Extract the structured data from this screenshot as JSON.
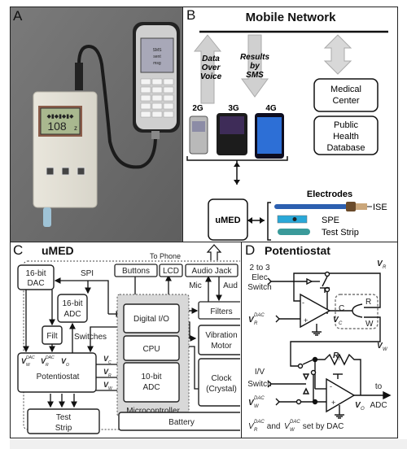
{
  "figure": {
    "panels": {
      "a": {
        "label": "A",
        "device_lcd": {
          "top_row": "◆▮◆▮◆▮◆",
          "reading": "108",
          "unit_mark": "z"
        },
        "phone_screen_lines": [
          "SMS",
          "sent",
          "msg"
        ]
      },
      "b": {
        "label": "B",
        "title": "Mobile Network",
        "arrow_up_text": [
          "Data",
          "Over",
          "Voice"
        ],
        "arrow_down_text": [
          "Results",
          "by",
          "SMS"
        ],
        "phone_generations": [
          "2G",
          "3G",
          "4G"
        ],
        "boxes": {
          "medical_center": [
            "Medical",
            "Center"
          ],
          "public_health": [
            "Public",
            "Health",
            "Database"
          ],
          "umed": "uMED"
        },
        "electrodes_title": "Electrodes",
        "electrodes": [
          "ISE",
          "SPE",
          "Test Strip"
        ]
      },
      "c": {
        "label": "C",
        "title": "uMED",
        "to_phone": "To Phone",
        "blocks": {
          "dac": [
            "16-bit",
            "DAC"
          ],
          "spi": "SPI",
          "adc16": [
            "16-bit",
            "ADC"
          ],
          "filt": "Filt",
          "switches": "Switches",
          "potentiostat": "Potentiostat",
          "pot_inputs": [
            "V",
            "V",
            "V"
          ],
          "pot_input_sup": [
            "DAC",
            "DAC",
            ""
          ],
          "pot_input_sub": [
            "W",
            "R",
            "O"
          ],
          "pot_outputs": [
            "V",
            "V",
            "V"
          ],
          "pot_output_sub": [
            "C",
            "R",
            "W"
          ],
          "buttons": "Buttons",
          "lcd": "LCD",
          "audio_jack": "Audio Jack",
          "mic": "Mic",
          "aud": "Aud",
          "filters": "Filters",
          "digital_io": "Digital I/O",
          "cpu": "CPU",
          "adc10": [
            "10-bit",
            "ADC"
          ],
          "microcontroller": "Microcontroller",
          "vibration_motor": [
            "Vibration",
            "Motor"
          ],
          "clock": [
            "Clock",
            "(Crystal)"
          ],
          "test_strip": [
            "Test",
            "Strip"
          ],
          "battery": "Battery"
        }
      },
      "d": {
        "label": "D",
        "title": "Potentiostat",
        "elec_switch": [
          "2 to 3",
          "Elec",
          "Switch"
        ],
        "iv_switch": [
          "I/V",
          "Switch"
        ],
        "vr_label": "V",
        "vr_sub": "R",
        "vw_label": "V",
        "vw_sub": "W",
        "vc_label": "V",
        "vc_sub": "C",
        "vo_label": "V",
        "vo_sub": "O",
        "vrdac_label": "V",
        "vrdac_sub": "R",
        "vrdac_sup": "DAC",
        "vwdac_label": "V",
        "vwdac_sub": "W",
        "vwdac_sup": "DAC",
        "rf_label": "R",
        "rf_sub": "f",
        "cell_labels": [
          "C",
          "R",
          "W"
        ],
        "to_adc": [
          "to",
          "ADC"
        ],
        "footnote_parts": [
          "V",
          "R",
          "DAC",
          " and ",
          "V",
          "W",
          "DAC",
          " set by DAC"
        ]
      }
    }
  }
}
